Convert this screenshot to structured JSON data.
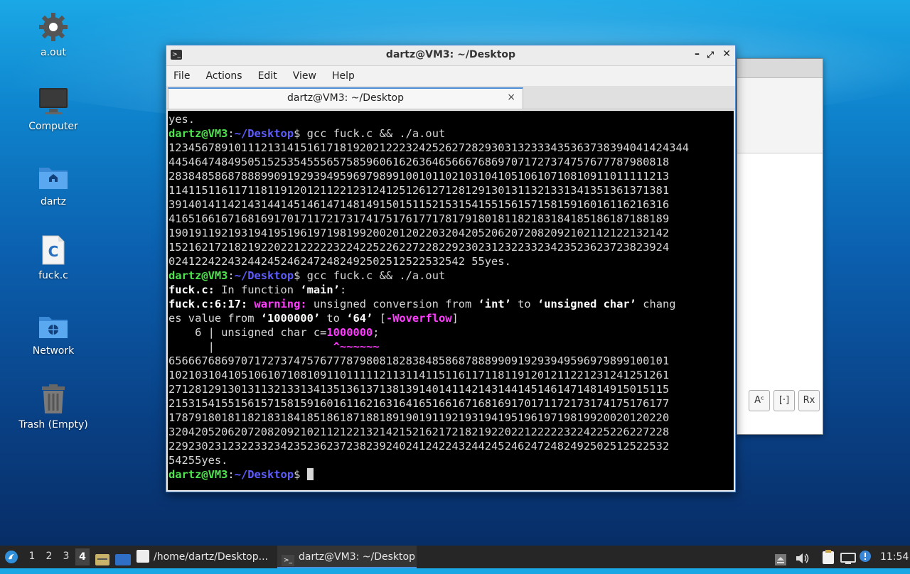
{
  "desktop": {
    "icons": [
      {
        "label": "a.out",
        "icon": "gear-icon"
      },
      {
        "label": "Computer",
        "icon": "monitor-icon"
      },
      {
        "label": "dartz",
        "icon": "home-folder-icon"
      },
      {
        "label": "fuck.c",
        "icon": "c-file-icon",
        "glyph": "C"
      },
      {
        "label": "Network",
        "icon": "network-folder-icon"
      },
      {
        "label": "Trash (Empty)",
        "icon": "trash-icon"
      }
    ]
  },
  "terminal": {
    "title": "dartz@VM3: ~/Desktop",
    "menu": [
      "File",
      "Actions",
      "Edit",
      "View",
      "Help"
    ],
    "tab_label": "dartz@VM3: ~/Desktop",
    "tab_close": "×",
    "prompt_user": "dartz@VM3",
    "prompt_sep": ":",
    "prompt_path": "~/Desktop",
    "prompt_sym": "$ ",
    "command": "gcc fuck.c && ./a.out",
    "line_yes": "yes.",
    "output1": [
      "1234567891011121314151617181920212223242526272829303132333435363738394041424344",
      "4454647484950515253545556575859606162636465666768697071727374757677787980818",
      "2838485868788899091929394959697989910010110210310410510610710810911011111213",
      "1141151161171181191201211221231241251261271281291301311321331341351361371381",
      "3914014114214314414514614714814915015115215315415515615715815916016116216316",
      "4165166167168169170171172173174175176177178179180181182183184185186187188189",
      "1901911921931941951961971981992002012022032042052062072082092102112122132142",
      "1521621721821922022122222322422522622722822923023123223323423523623723823924",
      "024122422432442452462472482492502512522532542 55yes."
    ],
    "warn_file": "fuck.c:",
    "warn_in": " In function ",
    "warn_fn": "‘main’",
    "warn_colon": ":",
    "warn_loc": "fuck.c:6:17: ",
    "warn_label": "warning: ",
    "warn_t1": "unsigned conversion from ",
    "warn_int": "‘int’",
    "warn_t2": " to ",
    "warn_uc": "‘unsigned char’",
    "warn_t3": " chang",
    "warn_t4": "es value from ",
    "warn_v1": "‘1000000’",
    "warn_t5": " to ",
    "warn_v2": "‘64’",
    "warn_t6": " [",
    "warn_flag": "-Woverflow",
    "warn_t7": "]",
    "code_prefix": "    6 | unsigned char c=",
    "code_value": "1000000",
    "code_end": ";",
    "caret_prefix": "      |                  ",
    "caret": "^~~~~~~",
    "output2": [
      "6566676869707172737475767778798081828384858687888990919293949596979899100101",
      "1021031041051061071081091101111121131141151161171181191201211221231241251261",
      "2712812913013113213313413513613713813914014114214314414514614714814915015115",
      "2153154155156157158159160161162163164165166167168169170171172173174175176177",
      "1787918018118218318418518618718818919019119219319419519619719819920020120220",
      "3204205206207208209210211212213214215216217218219220221222223224225226227228",
      "2292302312322332342352362372382392402412422432442452462472482492502512522532",
      "54255yes."
    ]
  },
  "taskbar": {
    "workspaces": [
      "1",
      "2",
      "3",
      "4"
    ],
    "active_workspace": "4",
    "tasks": [
      {
        "label": "/home/dartz/Desktop...",
        "icon": "text-editor-icon"
      },
      {
        "label": "dartz@VM3: ~/Desktop",
        "icon": "terminal-icon"
      }
    ],
    "clock": "11:54"
  },
  "bg_window": {
    "buttons": [
      "Aᶜ",
      "[·]",
      "Rx"
    ]
  },
  "colors": {
    "prompt_green": "#4ee44e",
    "path_blue": "#5c5cff",
    "warning_magenta": "#ff3cff",
    "accent": "#4d8ed8"
  }
}
